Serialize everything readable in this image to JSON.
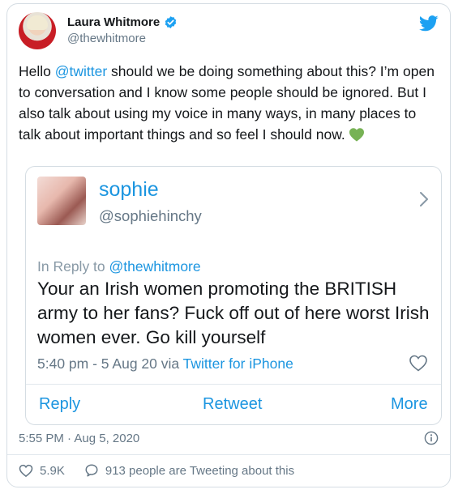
{
  "author": {
    "display_name": "Laura Whitmore",
    "handle": "@thewhitmore"
  },
  "tweet": {
    "text_before_mention": "Hello ",
    "mention": "@twitter",
    "text_after_mention": " should we be doing something about this? I’m open to conversation and I know some people should be ignored. But I also talk about using my voice in many ways, in many places to talk about important things and so feel I should now.",
    "heart_color": "#77b255"
  },
  "quoted": {
    "display_name": "sophie",
    "handle": "@sophiehinchy",
    "reply_prefix": "In Reply to ",
    "reply_to": "@thewhitmore",
    "text": "Your an Irish women promoting the BRITISH army to her fans? Fuck off out of here worst Irish women ever. Go kill yourself",
    "meta_time": "5:40 pm - 5 Aug 20 via ",
    "meta_source": "Twitter for iPhone",
    "actions": {
      "reply": "Reply",
      "retweet": "Retweet",
      "more": "More"
    }
  },
  "timestamp": "5:55 PM · Aug 5, 2020",
  "stats": {
    "likes": "5.9K",
    "tweeting": "913 people are Tweeting about this"
  },
  "colors": {
    "accent": "#1b95e0",
    "muted": "#657786",
    "border": "#d5dde3"
  }
}
